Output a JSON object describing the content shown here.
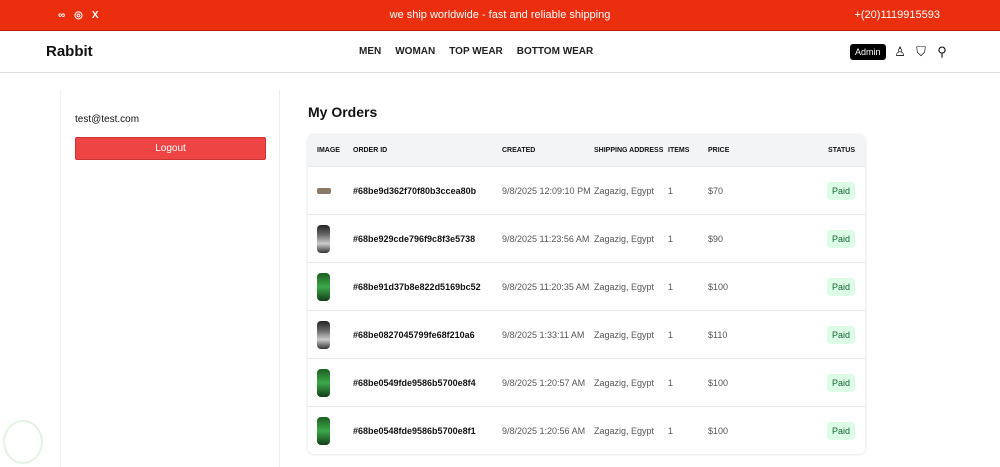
{
  "topbar": {
    "message": "we ship worldwide - fast and reliable shipping",
    "phone": "+(20)1119915593",
    "social": [
      "meta-icon",
      "instagram-icon",
      "x-icon"
    ]
  },
  "nav": {
    "logo": "Rabbit",
    "links": [
      "MEN",
      "WOMAN",
      "TOP WEAR",
      "BOTTOM WEAR"
    ],
    "admin": "Admin"
  },
  "sidebar": {
    "email": "test@test.com",
    "logout": "Logout"
  },
  "orders": {
    "title": "My Orders",
    "headers": [
      "IMAGE",
      "ORDER ID",
      "CREATED",
      "SHIPPING ADDRESS",
      "ITEMS",
      "PRICE",
      "STATUS"
    ],
    "rows": [
      {
        "id": "#68be9d362f70f80b3ccea80b",
        "created": "9/8/2025 12:09:10 PM",
        "address": "Zagazig, Egypt",
        "items": "1",
        "price": "$70",
        "status": "Paid"
      },
      {
        "id": "#68be929cde796f9c8f3e5738",
        "created": "9/8/2025 11:23:56 AM",
        "address": "Zagazig, Egypt",
        "items": "1",
        "price": "$90",
        "status": "Paid"
      },
      {
        "id": "#68be91d37b8e822d5169bc52",
        "created": "9/8/2025 11:20:35 AM",
        "address": "Zagazig, Egypt",
        "items": "1",
        "price": "$100",
        "status": "Paid"
      },
      {
        "id": "#68be0827045799fe68f210a6",
        "created": "9/8/2025 1:33:11 AM",
        "address": "Zagazig, Egypt",
        "items": "1",
        "price": "$110",
        "status": "Paid"
      },
      {
        "id": "#68be0549fde9586b5700e8f4",
        "created": "9/8/2025 1:20:57 AM",
        "address": "Zagazig, Egypt",
        "items": "1",
        "price": "$100",
        "status": "Paid"
      },
      {
        "id": "#68be0548fde9586b5700e8f1",
        "created": "9/8/2025 1:20:56 AM",
        "address": "Zagazig, Egypt",
        "items": "1",
        "price": "$100",
        "status": "Paid"
      }
    ]
  }
}
